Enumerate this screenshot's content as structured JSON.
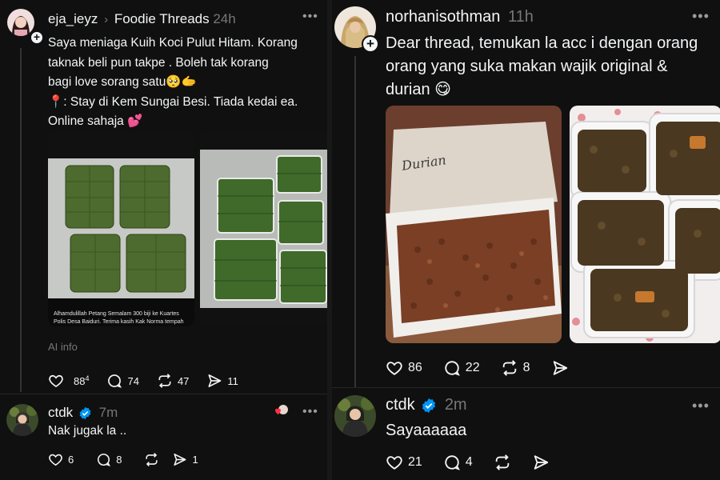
{
  "left": {
    "post": {
      "username": "eja_ieyz",
      "community": "Foodie Threads",
      "time": "24h",
      "lines": [
        "Saya meniaga Kuih Koci Pulut Hitam. Korang",
        "taknak beli pun takpe . Boleh tak korang",
        "bagi love sorang satu🥺🫱",
        "📍: Stay di Kem Sungai Besi. Tiada kedai ea.",
        "Online sahaja 💕"
      ],
      "caption_lines": [
        "Alhamdulillah Petang Semalam 300 biji ke Kuartes",
        "Polis Desa Baiduri. Terima kasih Kak Norma tempah"
      ],
      "ai_info": "AI info",
      "likes": "88",
      "likes_sup": "4",
      "replies": "74",
      "reposts": "47",
      "shares": "11"
    },
    "reply": {
      "username": "ctdk",
      "time": "7m",
      "text": "Nak jugak la ..",
      "likes": "6",
      "replies": "8",
      "shares": "1"
    }
  },
  "right": {
    "post": {
      "username": "norhanisothman",
      "time": "11h",
      "lines": [
        "Dear thread, temukan la acc i dengan orang",
        "orang yang suka makan wajik original &",
        "durian 😋"
      ],
      "container_label": "Durian",
      "likes": "86",
      "replies": "22",
      "reposts": "8"
    },
    "reply": {
      "username": "ctdk",
      "time": "2m",
      "text": "Sayaaaaaa",
      "likes": "21",
      "replies": "4"
    }
  },
  "icons": {
    "more": "more-icon",
    "heart": "heart-icon",
    "comment": "comment-icon",
    "repost": "repost-icon",
    "share": "share-icon",
    "verified": "verified-icon",
    "chevron": "chevron-right-icon"
  },
  "colors": {
    "background": "#101010",
    "text": "#f3f5f7",
    "muted": "#777777",
    "verified": "#0095f6"
  }
}
